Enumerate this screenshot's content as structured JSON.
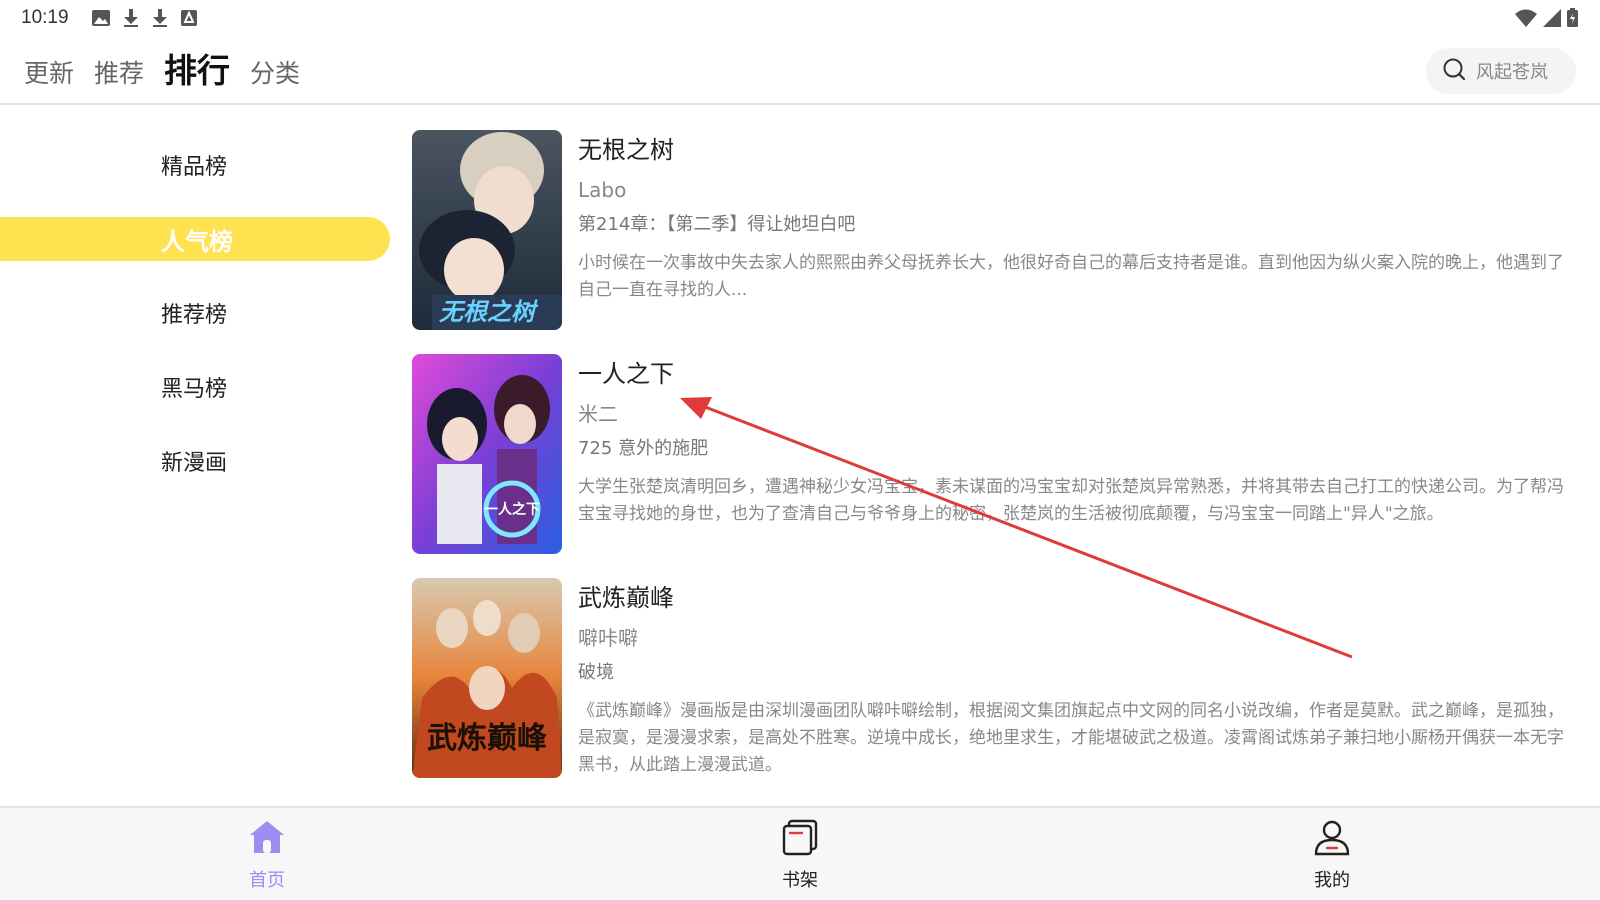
{
  "status_bar": {
    "time": "10:19"
  },
  "top_nav": {
    "tabs": [
      {
        "label": "更新"
      },
      {
        "label": "推荐"
      },
      {
        "label": "排行"
      },
      {
        "label": "分类"
      }
    ],
    "active_tab": "排行",
    "search_placeholder": "风起苍岚"
  },
  "sidebar": {
    "items": [
      {
        "label": "精品榜"
      },
      {
        "label": "人气榜"
      },
      {
        "label": "推荐榜"
      },
      {
        "label": "黑马榜"
      },
      {
        "label": "新漫画"
      }
    ],
    "active_item": "人气榜"
  },
  "books": [
    {
      "title": "无根之树",
      "author": "Labo",
      "chapter": "第214章：【第二季】得让她坦白吧",
      "description": "小时候在一次事故中失去家人的熙熙由养父母抚养长大，他很好奇自己的幕后支持者是谁。直到他因为纵火案入院的晚上，他遇到了自己一直在寻找的人...",
      "cover_text": "无根之树"
    },
    {
      "title": "一人之下",
      "author": "米二",
      "chapter": "725 意外的施肥",
      "description": "大学生张楚岚清明回乡，遭遇神秘少女冯宝宝，素未谋面的冯宝宝却对张楚岚异常熟悉，并将其带去自己打工的快递公司。为了帮冯宝宝寻找她的身世，也为了查清自己与爷爷身上的秘密，张楚岚的生活被彻底颠覆，与冯宝宝一同踏上\"异人\"之旅。",
      "cover_text": "一人之下"
    },
    {
      "title": "武炼巅峰",
      "author": "噼咔噼",
      "chapter": "破境",
      "description": "《武炼巅峰》漫画版是由深圳漫画团队噼咔噼绘制，根据阅文集团旗起点中文网的同名小说改编，作者是莫默。武之巅峰，是孤独，是寂寞，是漫漫求索，是高处不胜寒。逆境中成长，绝地里求生，才能堪破武之极道。凌霄阁试炼弟子兼扫地小厮杨开偶获一本无字黑书，从此踏上漫漫武道。",
      "cover_text": "武炼巅峰"
    }
  ],
  "bottom_nav": {
    "items": [
      {
        "label": "首页",
        "icon": "home-icon"
      },
      {
        "label": "书架",
        "icon": "bookshelf-icon"
      },
      {
        "label": "我的",
        "icon": "profile-icon"
      }
    ],
    "active_item": "首页"
  },
  "colors": {
    "accent_yellow": "#ffe24f",
    "active_nav_purple": "#9b8ef0",
    "annotation_red": "#e03a3a"
  }
}
